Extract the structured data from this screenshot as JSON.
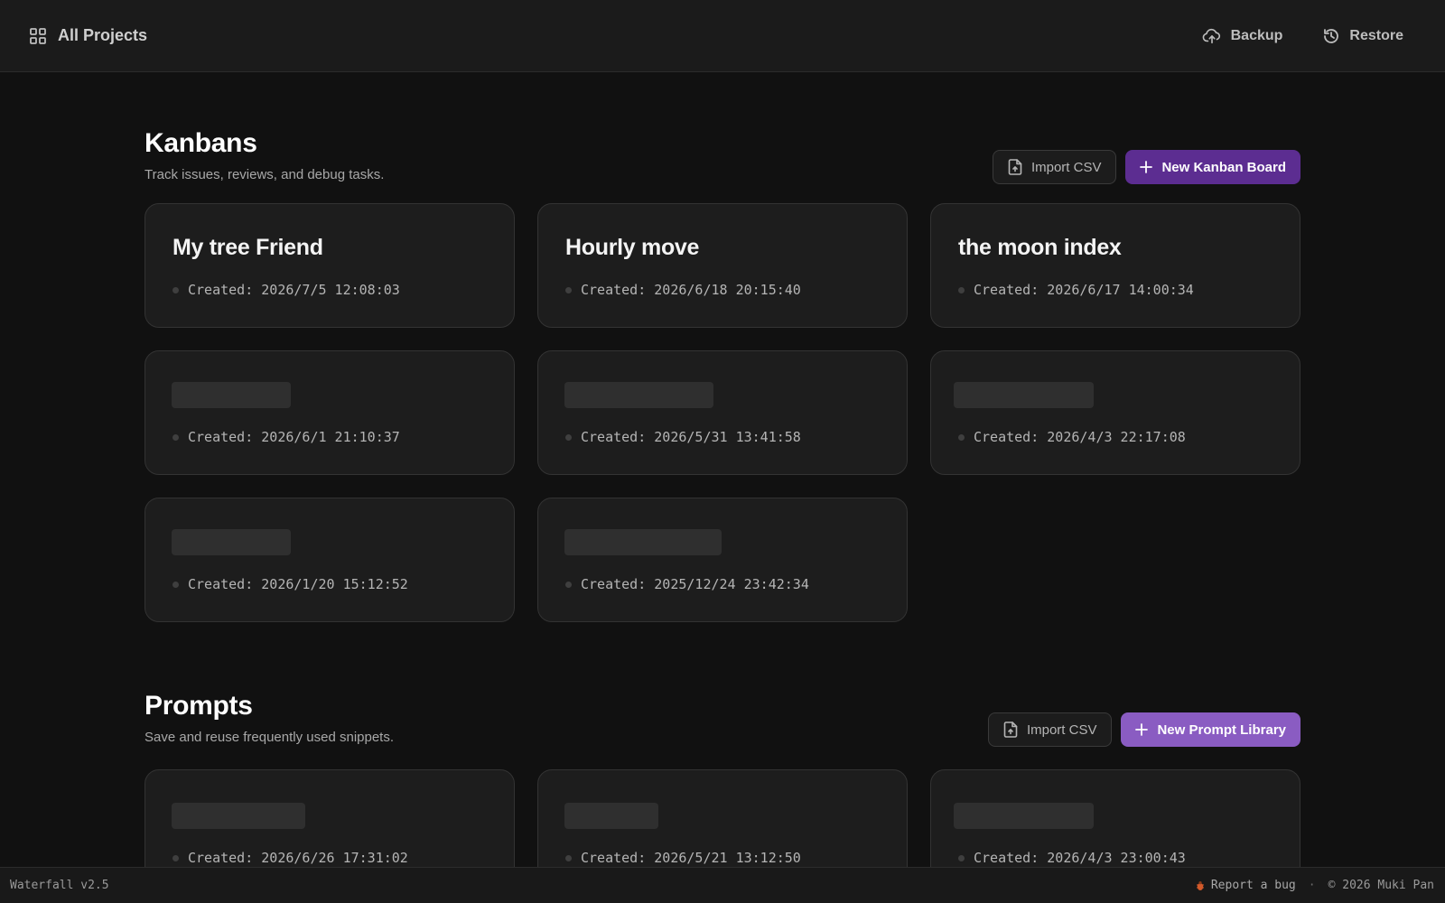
{
  "header": {
    "title": "All Projects",
    "backup_label": "Backup",
    "restore_label": "Restore"
  },
  "kanbans": {
    "title": "Kanbans",
    "subtitle": "Track issues, reviews, and debug tasks.",
    "import_label": "Import CSV",
    "new_label": "New Kanban Board",
    "cards": [
      {
        "title": "My tree Friend",
        "created": "Created: 2026/7/5 12:08:03"
      },
      {
        "title": "Hourly move",
        "created": "Created: 2026/6/18 20:15:40"
      },
      {
        "title": "the moon index",
        "created": "Created: 2026/6/17 14:00:34"
      },
      {
        "title": "",
        "created": "Created: 2026/6/1 21:10:37"
      },
      {
        "title": "",
        "created": "Created: 2026/5/31 13:41:58"
      },
      {
        "title": "",
        "created": "Created: 2026/4/3 22:17:08"
      },
      {
        "title": "",
        "created": "Created: 2026/1/20 15:12:52"
      },
      {
        "title": "",
        "created": "Created: 2025/12/24 23:42:34"
      }
    ]
  },
  "prompts": {
    "title": "Prompts",
    "subtitle": "Save and reuse frequently used snippets.",
    "import_label": "Import CSV",
    "new_label": "New Prompt Library",
    "cards": [
      {
        "title": "",
        "created": "Created: 2026/6/26 17:31:02"
      },
      {
        "title": "",
        "created": "Created: 2026/5/21 13:12:50"
      },
      {
        "title": "",
        "created": "Created: 2026/4/3 23:00:43"
      }
    ]
  },
  "footer": {
    "version": "Waterfall v2.5",
    "bug_label": "Report a bug",
    "separator": "·",
    "copyright": "© 2026 Muki Pan"
  },
  "colors": {
    "background": "#111111",
    "card": "#1d1d1d",
    "kanban_primary": "#5c2d91",
    "prompt_primary": "#8a5cc2"
  }
}
